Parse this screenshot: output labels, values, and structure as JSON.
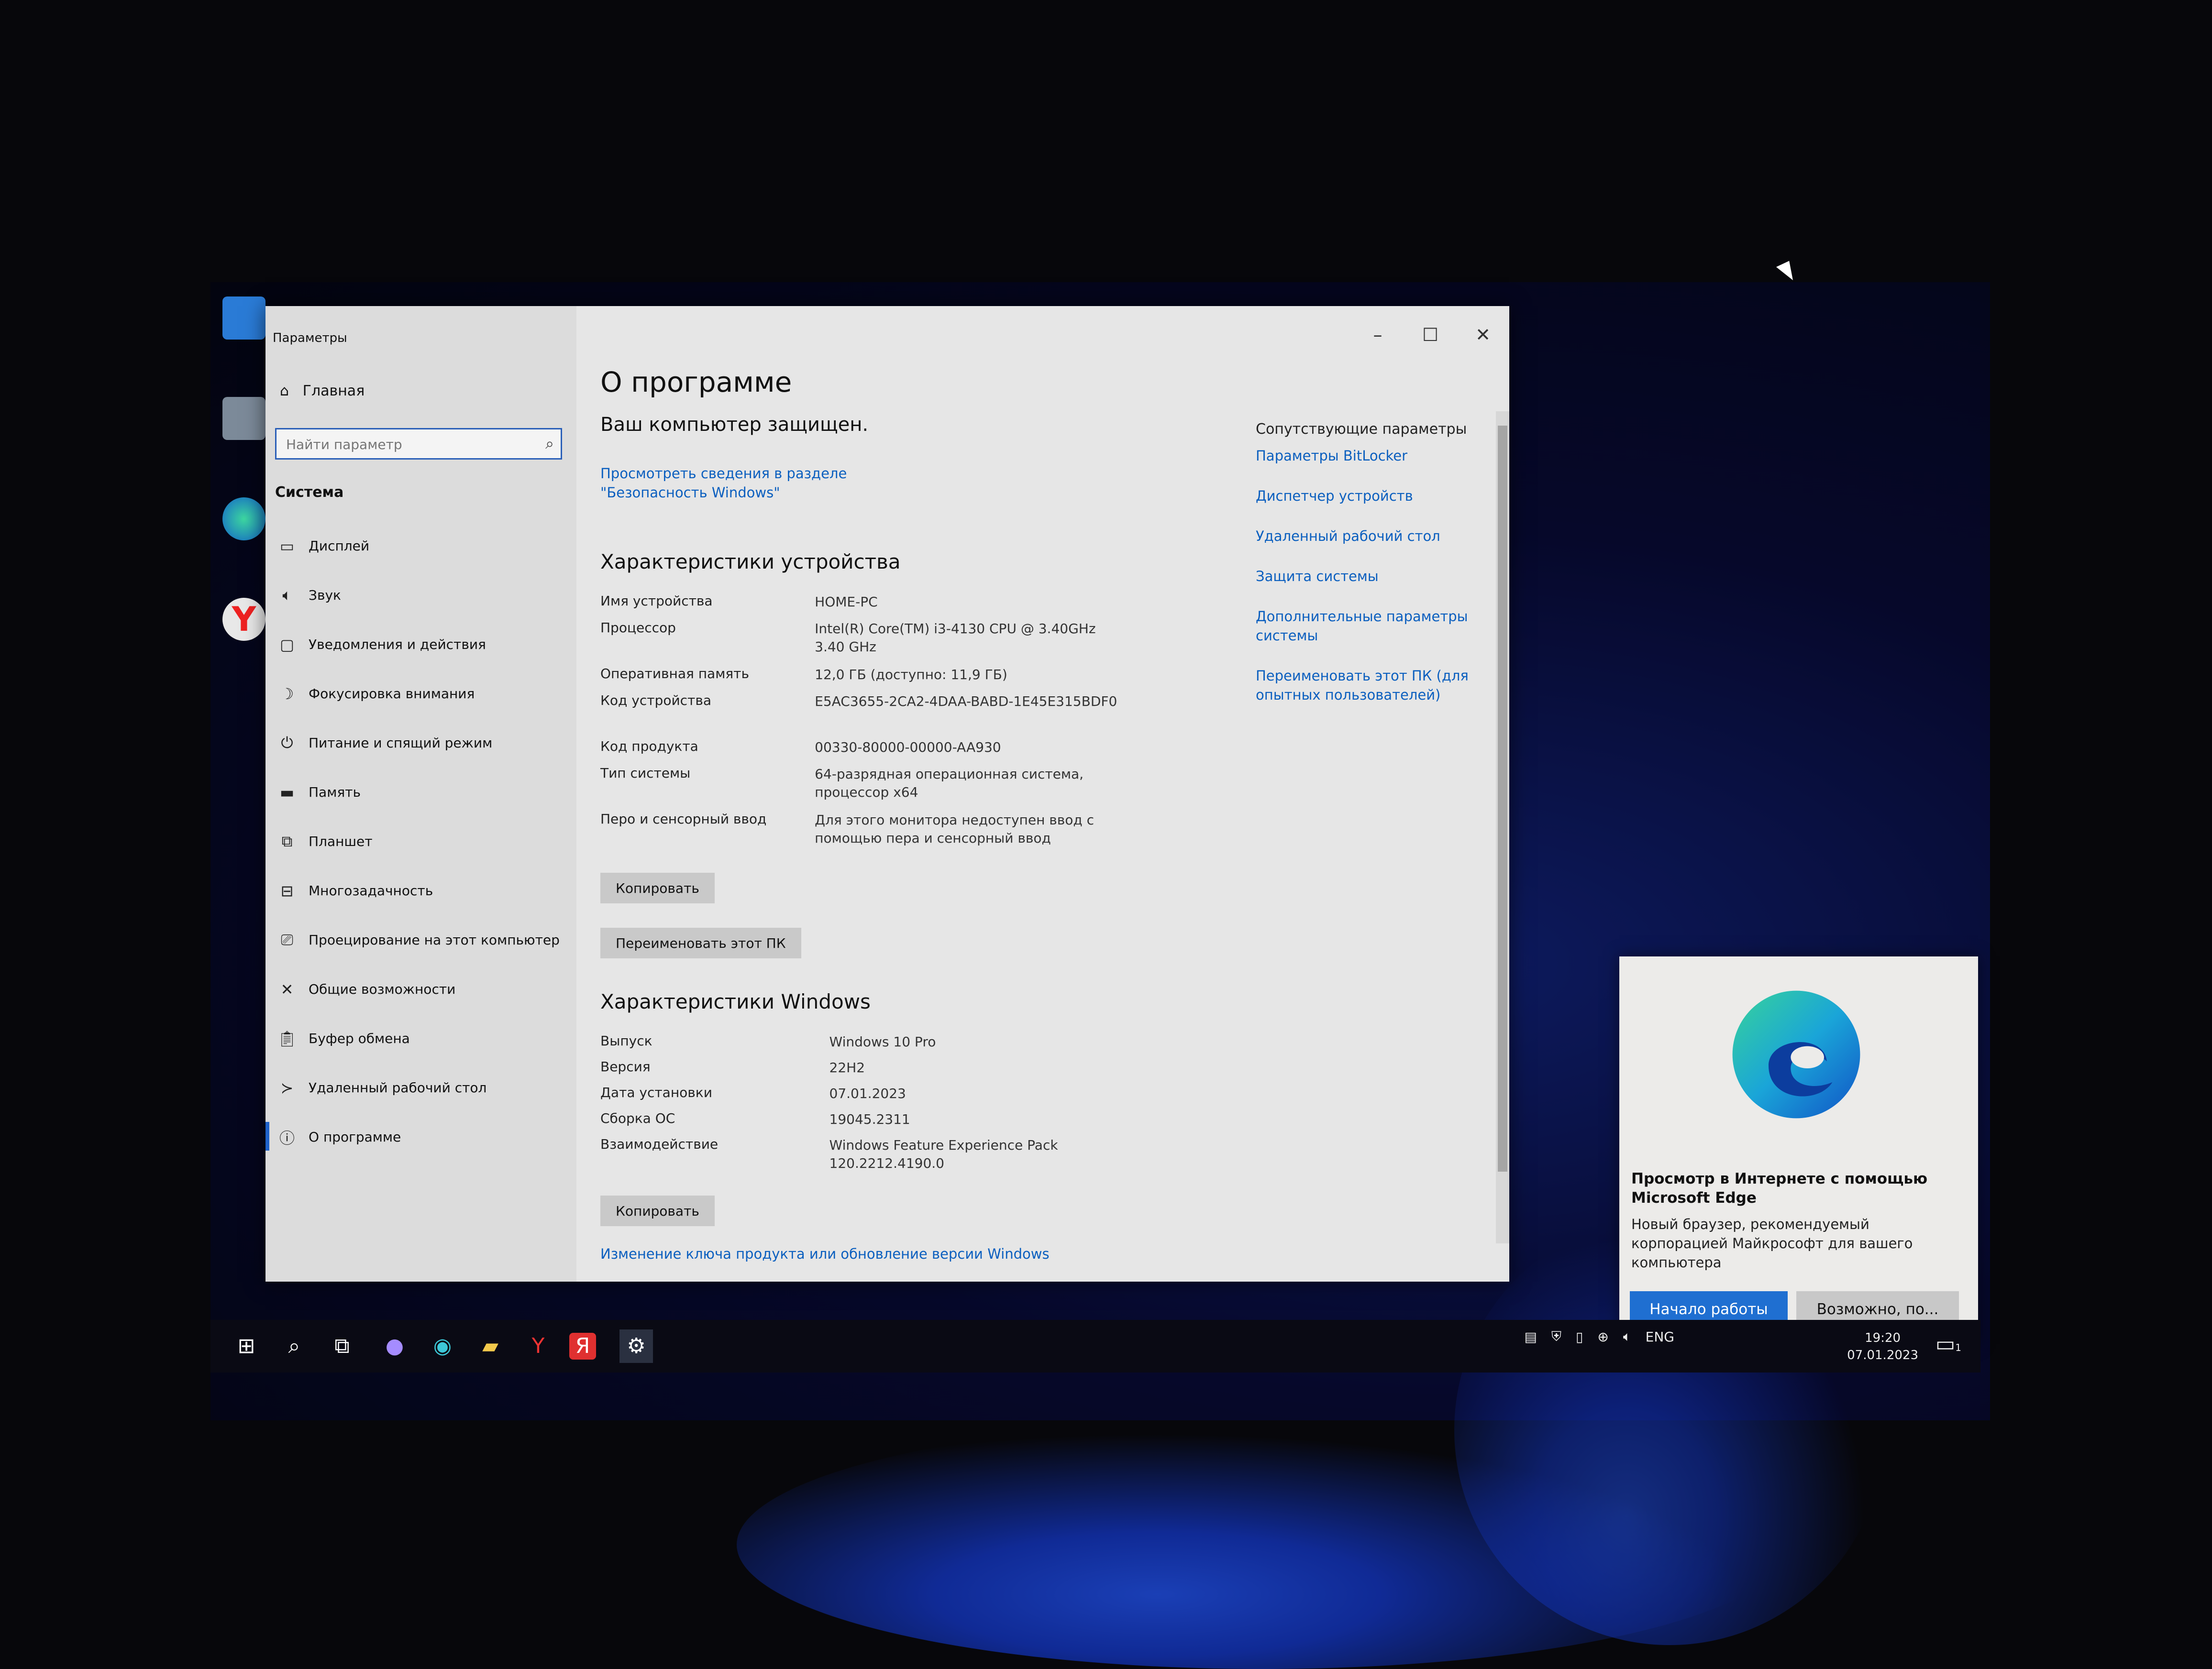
{
  "window": {
    "title": "Параметры"
  },
  "sidebar": {
    "home": "Главная",
    "search_placeholder": "Найти параметр",
    "section": "Система",
    "items": [
      {
        "label": "Дисплей",
        "icon": "monitor-icon"
      },
      {
        "label": "Звук",
        "icon": "speaker-icon"
      },
      {
        "label": "Уведомления и действия",
        "icon": "notification-icon"
      },
      {
        "label": "Фокусировка внимания",
        "icon": "moon-icon"
      },
      {
        "label": "Питание и спящий режим",
        "icon": "power-icon"
      },
      {
        "label": "Память",
        "icon": "storage-icon"
      },
      {
        "label": "Планшет",
        "icon": "tablet-icon"
      },
      {
        "label": "Многозадачность",
        "icon": "multitask-icon"
      },
      {
        "label": "Проецирование на этот компьютер",
        "icon": "project-icon"
      },
      {
        "label": "Общие возможности",
        "icon": "shared-icon"
      },
      {
        "label": "Буфер обмена",
        "icon": "clipboard-icon"
      },
      {
        "label": "Удаленный рабочий стол",
        "icon": "remote-icon"
      },
      {
        "label": "О программе",
        "icon": "info-icon"
      }
    ]
  },
  "main": {
    "title": "О программе",
    "protected": "Ваш компьютер защищен.",
    "security_link": "Просмотреть сведения в разделе \"Безопасность Windows\"",
    "device_heading": "Характеристики устройства",
    "device_specs": [
      {
        "key": "Имя устройства",
        "value": "HOME-PC"
      },
      {
        "key": "Процессор",
        "value": "Intel(R) Core(TM) i3-4130 CPU @ 3.40GHz 3.40 GHz"
      },
      {
        "key": "Оперативная память",
        "value": "12,0 ГБ (доступно: 11,9 ГБ)"
      },
      {
        "key": "Код устройства",
        "value": "E5AC3655-2CA2-4DAA-BABD-1E45E315BDF0"
      },
      {
        "key": "Код продукта",
        "value": "00330-80000-00000-AA930"
      },
      {
        "key": "Тип системы",
        "value": "64-разрядная операционная система, процессор x64"
      },
      {
        "key": "Перо и сенсорный ввод",
        "value": "Для этого монитора недоступен ввод с помощью пера и сенсорный ввод"
      }
    ],
    "copy_button": "Копировать",
    "rename_button": "Переименовать этот ПК",
    "windows_heading": "Характеристики Windows",
    "windows_specs": [
      {
        "key": "Выпуск",
        "value": "Windows 10 Pro"
      },
      {
        "key": "Версия",
        "value": "22H2"
      },
      {
        "key": "Дата установки",
        "value": "07.01.2023"
      },
      {
        "key": "Сборка ОС",
        "value": "19045.2311"
      },
      {
        "key": "Взаимодействие",
        "value": "Windows Feature Experience Pack 120.2212.4190.0"
      }
    ],
    "copy_button2": "Копировать",
    "change_key_link": "Изменение ключа продукта или обновление версии Windows"
  },
  "related": {
    "heading": "Сопутствующие параметры",
    "links": [
      "Параметры BitLocker",
      "Диспетчер устройств",
      "Удаленный рабочий стол",
      "Защита системы",
      "Дополнительные параметры системы",
      "Переименовать этот ПК (для опытных пользователей)"
    ]
  },
  "toast": {
    "title": "Просмотр в Интернете с помощью Microsoft Edge",
    "body": "Новый браузер, рекомендуемый корпорацией Майкрософт для вашего компьютера",
    "primary": "Начало работы",
    "secondary": "Возможно, по..."
  },
  "taskbar": {
    "lang": "ENG",
    "time": "19:20",
    "date": "07.01.2023",
    "notif_count": "1"
  },
  "colors": {
    "accent": "#1f6fd1",
    "link": "#0b5fbf"
  }
}
